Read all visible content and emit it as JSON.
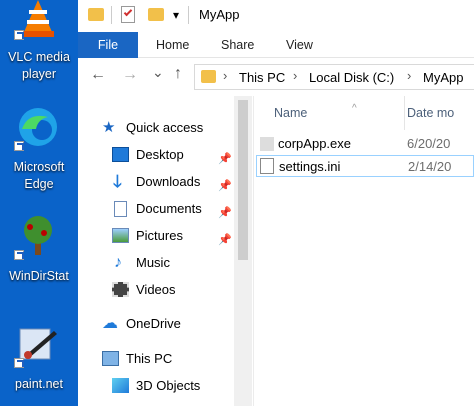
{
  "desktop": {
    "icons": [
      {
        "icon": "vlc-icon",
        "label": "VLC media player"
      },
      {
        "icon": "edge-icon",
        "label": "Microsoft Edge"
      },
      {
        "icon": "windirstat-icon",
        "label": "WinDirStat"
      },
      {
        "icon": "paint-icon",
        "label": "paint.net"
      }
    ]
  },
  "titlebar": {
    "title": "MyApp",
    "qat_dropdown": "▾"
  },
  "ribbon": {
    "tabs": [
      "File",
      "Home",
      "Share",
      "View"
    ]
  },
  "address": {
    "back": "←",
    "forward": "→",
    "dropdown": "⌄",
    "up": "↑",
    "crumbs": [
      "This PC",
      "Local Disk (C:)",
      "MyApp"
    ],
    "separator": "›"
  },
  "nav": {
    "quick_access": "Quick access",
    "items": [
      {
        "label": "Desktop",
        "pinned": true
      },
      {
        "label": "Downloads",
        "pinned": true
      },
      {
        "label": "Documents",
        "pinned": true
      },
      {
        "label": "Pictures",
        "pinned": true
      },
      {
        "label": "Music",
        "pinned": false
      },
      {
        "label": "Videos",
        "pinned": false
      }
    ],
    "onedrive": "OneDrive",
    "this_pc": "This PC",
    "objects3d": "3D Objects",
    "pin_glyph": "📌"
  },
  "content": {
    "col_name": "Name",
    "col_date": "Date mo",
    "sort_glyph": "^",
    "files": [
      {
        "name": "corpApp.exe",
        "date": "6/20/20",
        "icon": "exe-icon"
      },
      {
        "name": "settings.ini",
        "date": "2/14/20",
        "icon": "ini-file-icon",
        "selected": true
      }
    ]
  },
  "colors": {
    "desktop": "#0a63c9",
    "file_tab": "#1a66c3",
    "folder": "#f2c04a",
    "selection_border": "#99d1ff"
  }
}
